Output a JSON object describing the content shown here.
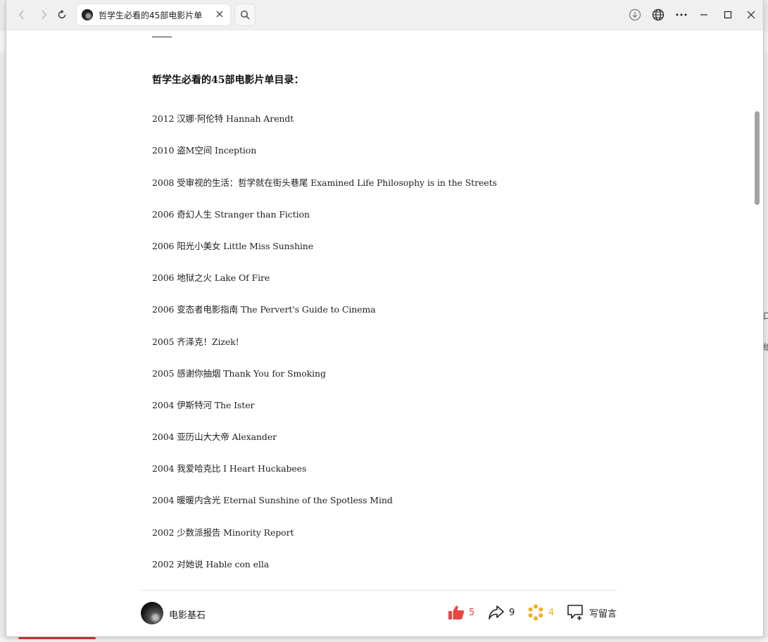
{
  "browser": {
    "tab_title": "哲学生必看的45部电影片单"
  },
  "article": {
    "toc_title": "哲学生必看的45部电影片单目录：",
    "films": [
      "2012 汉娜·阿伦特 Hannah Arendt",
      "2010 盗M空间 Inception",
      "2008 受审视的生活：哲学就在街头巷尾 Examined Life Philosophy is in the Streets",
      "2006 奇幻人生 Stranger than Fiction",
      "2006 阳光小美女 Little Miss Sunshine",
      "2006 地狱之火 Lake Of Fire",
      "2006 变态者电影指南 The Pervert's Guide to Cinema",
      "2005 齐泽克！Zizek!",
      "2005 感谢你抽烟 Thank You for Smoking",
      "2004 伊斯特河 The Ister",
      "2004 亚历山大大帝 Alexander",
      "2004 我爱哈克比 I Heart Huckabees",
      "2004 暖暖内含光 Eternal Sunshine of the Spotless Mind",
      "2002 少数派报告 Minority Report",
      "2002 对她说 Hable con ella"
    ]
  },
  "footer": {
    "author": "电影基石",
    "like_count": "5",
    "share_count": "9",
    "star_count": "4",
    "comment_label": "写留言"
  },
  "colors": {
    "like": "#e8463f",
    "star": "#f0b21c"
  },
  "icons": [
    "back-icon",
    "forward-icon",
    "reload-icon",
    "close-icon",
    "search-icon",
    "download-icon",
    "globe-icon",
    "more-icon",
    "minimize-icon",
    "maximize-icon",
    "window-close-icon",
    "thumb-up-icon",
    "share-icon",
    "star-icon",
    "comment-icon"
  ]
}
